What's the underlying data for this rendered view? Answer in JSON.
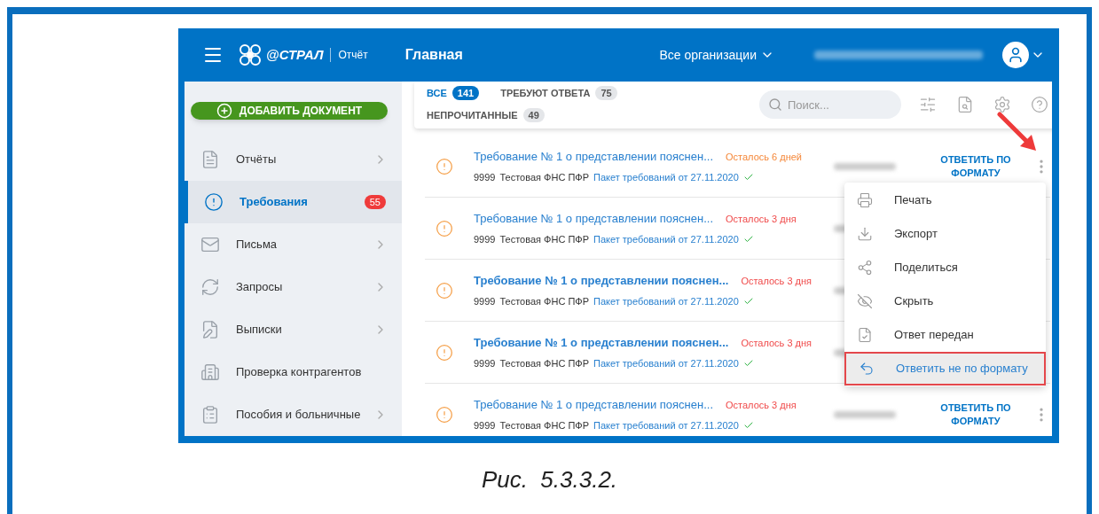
{
  "header": {
    "logo_text": "@СТРАЛ",
    "product": "Отчёт",
    "title": "Главная",
    "org_selector": "Все организации"
  },
  "sidebar": {
    "add_button": "ДОБАВИТЬ ДОКУМЕНТ",
    "items": [
      {
        "label": "Отчёты",
        "kind": "reports",
        "chevron": true,
        "selected": false
      },
      {
        "label": "Требования",
        "kind": "alert",
        "chevron": false,
        "badge": "55",
        "selected": true
      },
      {
        "label": "Письма",
        "kind": "mail",
        "chevron": true,
        "selected": false
      },
      {
        "label": "Запросы",
        "kind": "refresh",
        "chevron": true,
        "selected": false
      },
      {
        "label": "Выписки",
        "kind": "edit",
        "chevron": true,
        "selected": false
      },
      {
        "label": "Проверка контрагентов",
        "kind": "check",
        "chevron": false,
        "selected": false
      },
      {
        "label": "Пособия и больничные",
        "kind": "clipboard",
        "chevron": true,
        "selected": false
      }
    ]
  },
  "tabs": [
    {
      "label": "ВСЕ",
      "count": "141",
      "selected": true
    },
    {
      "label": "ТРЕБУЮТ ОТВЕТА",
      "count": "75",
      "selected": false
    },
    {
      "label": "НЕПРОЧИТАННЫЕ",
      "count": "49",
      "selected": false
    }
  ],
  "search": {
    "placeholder": "Поиск..."
  },
  "rows": [
    {
      "title": "Требование № 1 о представлении пояснен...",
      "unread": false,
      "deadline": "Осталось 6 дней",
      "color": "#f5883a",
      "code": "9999",
      "org": "Тестовая ФНС ПФР",
      "package": "Пакет требований от 27.11.2020",
      "action": "ОТВЕТИТЬ ПО ФОРМАТУ"
    },
    {
      "title": "Требование № 1 о представлении пояснен...",
      "unread": false,
      "deadline": "Осталось 3 дня",
      "color": "#f04a4a",
      "code": "9999",
      "org": "Тестовая ФНС ПФР",
      "package": "Пакет требований от 27.11.2020"
    },
    {
      "title": "Требование № 1 о представлении пояснен...",
      "unread": true,
      "deadline": "Осталось 3 дня",
      "color": "#f04a4a",
      "code": "9999",
      "org": "Тестовая ФНС ПФР",
      "package": "Пакет требований от 27.11.2020"
    },
    {
      "title": "Требование № 1 о представлении пояснен...",
      "unread": true,
      "deadline": "Осталось 3 дня",
      "color": "#f04a4a",
      "code": "9999",
      "org": "Тестовая ФНС ПФР",
      "package": "Пакет требований от 27.11.2020"
    },
    {
      "title": "Требование № 1 о представлении пояснен...",
      "unread": false,
      "deadline": "Осталось 3 дня",
      "color": "#f04a4a",
      "code": "9999",
      "org": "Тестовая ФНС ПФР",
      "package": "Пакет требований от 27.11.2020",
      "action": "ОТВЕТИТЬ ПО ФОРМАТУ"
    }
  ],
  "context_menu": [
    {
      "label": "Печать",
      "kind": "print",
      "selected": false
    },
    {
      "label": "Экспорт",
      "kind": "download",
      "selected": false
    },
    {
      "label": "Поделиться",
      "kind": "share",
      "selected": false
    },
    {
      "label": "Скрыть",
      "kind": "hide",
      "selected": false
    },
    {
      "label": "Ответ передан",
      "kind": "file",
      "selected": false
    },
    {
      "label": "Ответить не по формату",
      "kind": "reply",
      "selected": true
    }
  ],
  "caption": "Рис.  5.3.3.2."
}
